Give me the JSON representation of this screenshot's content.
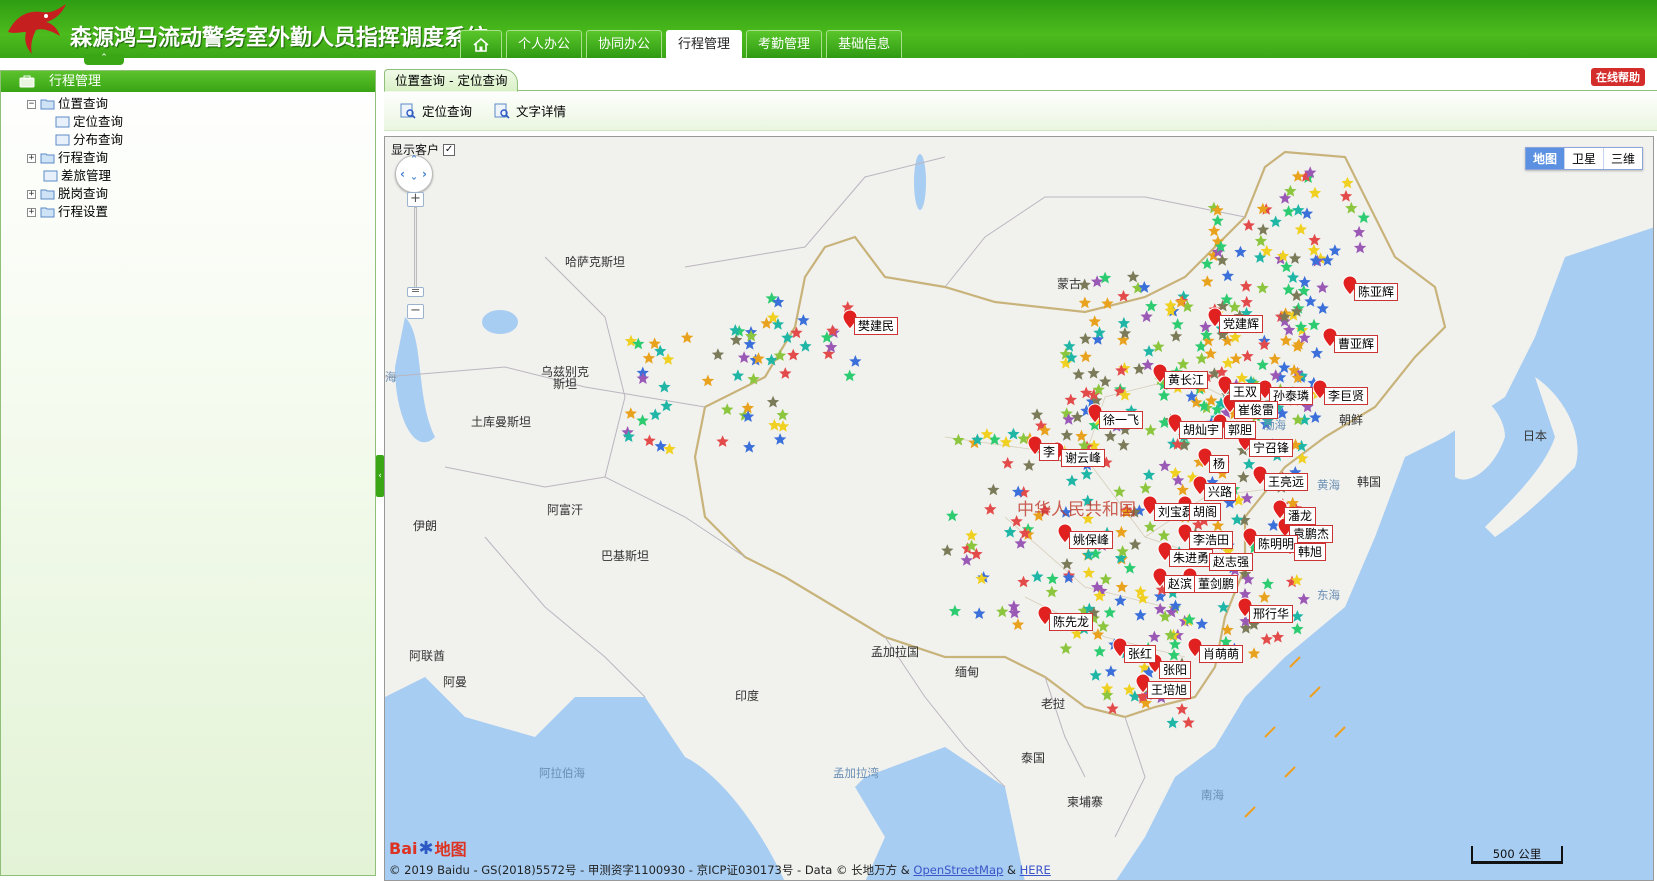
{
  "app": {
    "title": "森源鸿马流动警务室外勤人员指挥调度系统"
  },
  "nav": {
    "home_icon": "home-icon",
    "tabs": [
      {
        "label": "个人办公"
      },
      {
        "label": "协同办公"
      },
      {
        "label": "行程管理",
        "active": true
      },
      {
        "label": "考勤管理"
      },
      {
        "label": "基础信息"
      }
    ]
  },
  "sidebar": {
    "title": "行程管理",
    "tree": [
      {
        "label": "位置查询",
        "expanded": true
      },
      {
        "label": "定位查询"
      },
      {
        "label": "分布查询"
      },
      {
        "label": "行程查询",
        "expanded": false
      },
      {
        "label": "差旅管理"
      },
      {
        "label": "脱岗查询",
        "expanded": false
      },
      {
        "label": "行程设置",
        "expanded": false
      }
    ]
  },
  "main": {
    "breadcrumb_tab": "位置查询 - 定位查询",
    "help_label": "在线帮助",
    "toolbar": {
      "locate_label": "定位查询",
      "detail_label": "文字详情"
    }
  },
  "map": {
    "show_customers_label": "显示客户",
    "show_customers_checked": true,
    "map_types": [
      "地图",
      "卫星",
      "三维"
    ],
    "active_map_type": "地图",
    "place_labels": {
      "kazakhstan": "哈萨克斯坦",
      "mongolia": "蒙古",
      "uzbekistan_1": "乌兹别克",
      "uzbekistan_2": "斯坦",
      "turkmenistan": "土库曼斯坦",
      "iran": "伊朗",
      "afghanistan": "阿富汗",
      "pakistan": "巴基斯坦",
      "india": "印度",
      "bangladesh": "孟加拉国",
      "myanmar": "缅甸",
      "laos": "老挝",
      "thailand": "泰国",
      "cambodia": "柬埔寨",
      "japan": "日本",
      "korea": "韩国",
      "north_korea": "朝鲜",
      "uae": "阿联酋",
      "oman": "阿曼",
      "china": "中华人民共和国",
      "bohai": "渤海",
      "yellow_sea": "黄海",
      "east_sea": "东海",
      "south_sea": "南海",
      "arabian_sea": "阿拉伯海",
      "bay_of_bengal": "孟加拉湾",
      "sea_west": "海"
    },
    "employees": [
      "陈亚辉",
      "党建辉",
      "樊建民",
      "曹亚辉",
      "黄长江",
      "王双",
      "孙泰璘",
      "李巨贤",
      "崔俊雷",
      "徐一飞",
      "胡灿宇",
      "郭胆",
      "宁召锋",
      "李",
      "谢云峰",
      "杨",
      "王亮远",
      "刘宝磊",
      "胡阁",
      "兴路",
      "潘龙",
      "袁鹏杰",
      "姚保峰",
      "陈明明",
      "韩旭",
      "李浩田",
      "朱进勇",
      "赵志强",
      "赵滨",
      "董剑鹏",
      "陈先龙",
      "邢行华",
      "张红",
      "肖萌萌",
      "张阳",
      "王培旭"
    ],
    "star_colors": [
      "#3b6fd9",
      "#e8a21d",
      "#1fb6a6",
      "#e34b4b",
      "#7b7b5a",
      "#8cc63f",
      "#9b59b6",
      "#2ecc71",
      "#f0d020"
    ],
    "copyright": "© 2019 Baidu - GS(2018)5572号 - 甲测资字1100930 - 京ICP证030173号 - Data © 长地万方 & ",
    "copyright_link1": "OpenStreetMap",
    "copyright_amp": " & ",
    "copyright_link2": "HERE",
    "baidu_logo_text": "Bai",
    "baidu_logo_text2": "地图",
    "scale_label": "500 公里"
  }
}
